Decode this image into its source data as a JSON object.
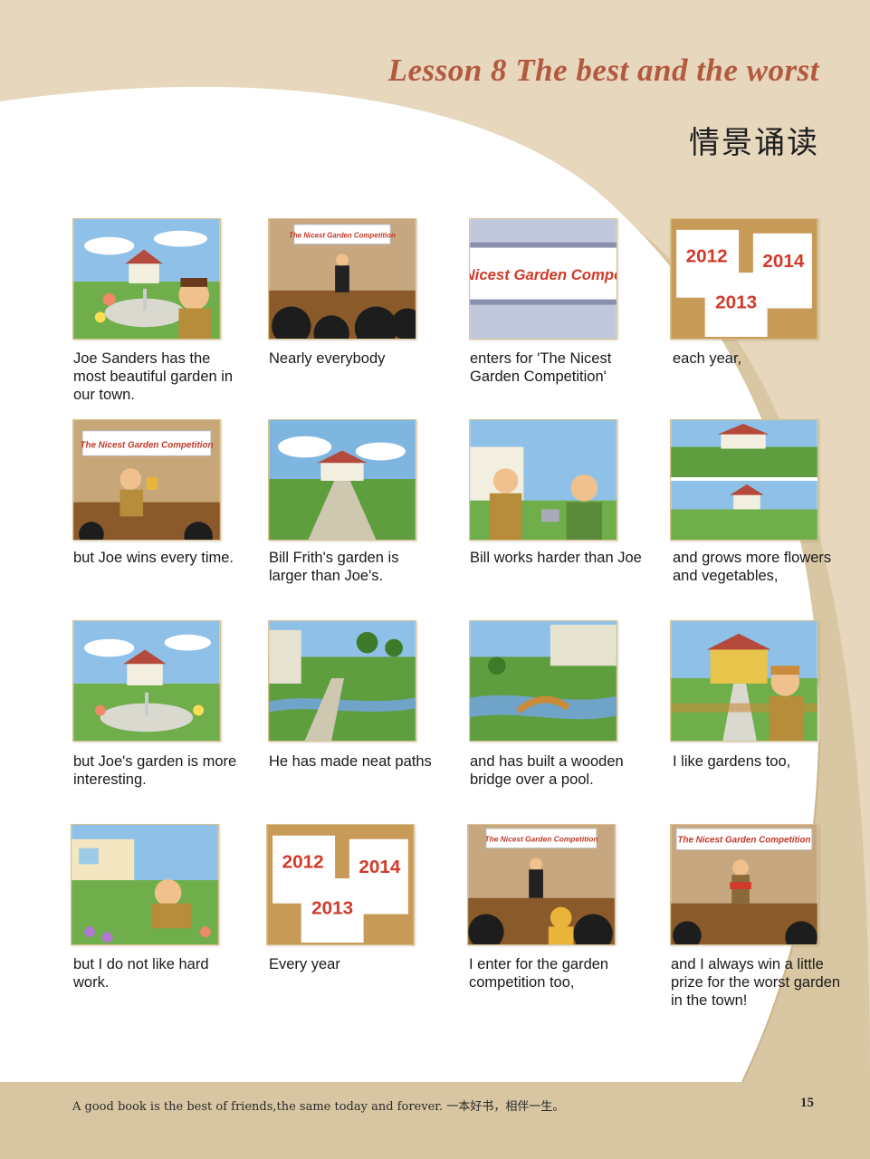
{
  "header": {
    "title": "Lesson 8  The best and the worst",
    "subtitle": "情景诵读"
  },
  "panels": [
    {
      "caption": "Joe Sanders has the most beautiful garden in our town.",
      "scene": "garden-with-joe"
    },
    {
      "caption": "Nearly everybody",
      "scene": "stage-host"
    },
    {
      "caption": "enters for 'The Nicest Garden Competition'",
      "scene": "banner-closeup",
      "banner_text": "Nicest Garden Compe"
    },
    {
      "caption": "each year,",
      "scene": "calendars",
      "years": [
        "2012",
        "2014",
        "2013"
      ]
    },
    {
      "caption": "but Joe wins every time.",
      "scene": "joe-trophy"
    },
    {
      "caption": "Bill Frith's garden is larger than Joe's.",
      "scene": "bill-garden"
    },
    {
      "caption": "Bill works harder than Joe",
      "scene": "joe-and-bill"
    },
    {
      "caption": "and grows more flowers and vegetables,",
      "scene": "two-gardens"
    },
    {
      "caption": "but Joe's garden is more interesting.",
      "scene": "joe-garden"
    },
    {
      "caption": "He has made neat paths",
      "scene": "paths"
    },
    {
      "caption": "and has built a wooden bridge over a pool.",
      "scene": "bridge"
    },
    {
      "caption": "I like gardens too,",
      "scene": "narrator"
    },
    {
      "caption": "but I do not like hard work.",
      "scene": "narrator-relaxing"
    },
    {
      "caption": "Every year",
      "scene": "calendars",
      "years": [
        "2012",
        "2014",
        "2013"
      ]
    },
    {
      "caption": "I enter for the garden competition too,",
      "scene": "stage-host-audience"
    },
    {
      "caption": "and I always win a little prize for the worst garden in the town!",
      "scene": "narrator-prize"
    }
  ],
  "banner_text": "The Nicest Garden Competition",
  "footer": {
    "text": "A good book is the best of friends,the same today and forever. 一本好书，相伴一生。",
    "page_number": "15"
  },
  "colors": {
    "title": "#b25a40",
    "page_bg": "#e6d7bd",
    "white_area": "#ffffff",
    "panel_border": "#d8c18f"
  }
}
